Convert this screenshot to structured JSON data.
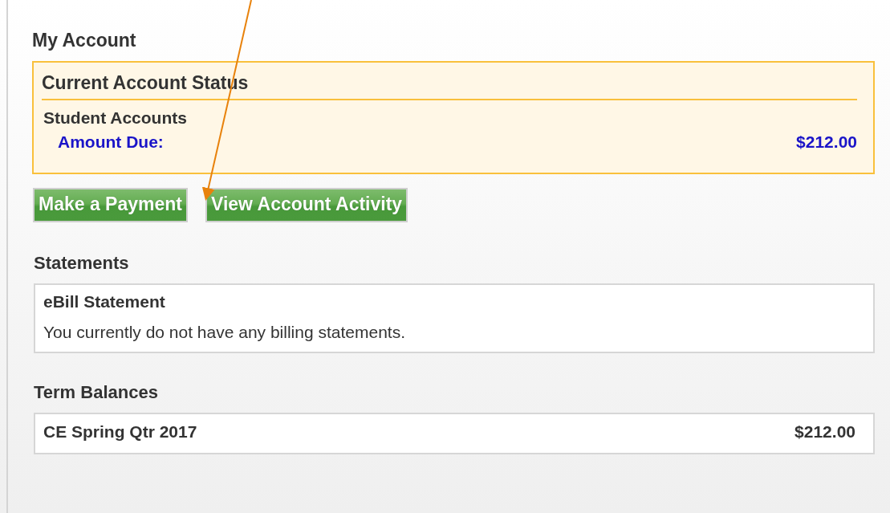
{
  "page_title": "My Account",
  "account_status": {
    "title": "Current Account Status",
    "section": "Student Accounts",
    "label": "Amount Due:",
    "amount": "$212.00"
  },
  "buttons": [
    "Make a Payment",
    "View Account Activity"
  ],
  "statements": {
    "heading": "Statements",
    "title": "eBill Statement",
    "message": "You currently do not have any billing statements."
  },
  "term_balances": {
    "heading": "Term Balances",
    "rows": [
      {
        "term": "CE Spring Qtr 2017",
        "amount": "$212.00"
      }
    ]
  }
}
